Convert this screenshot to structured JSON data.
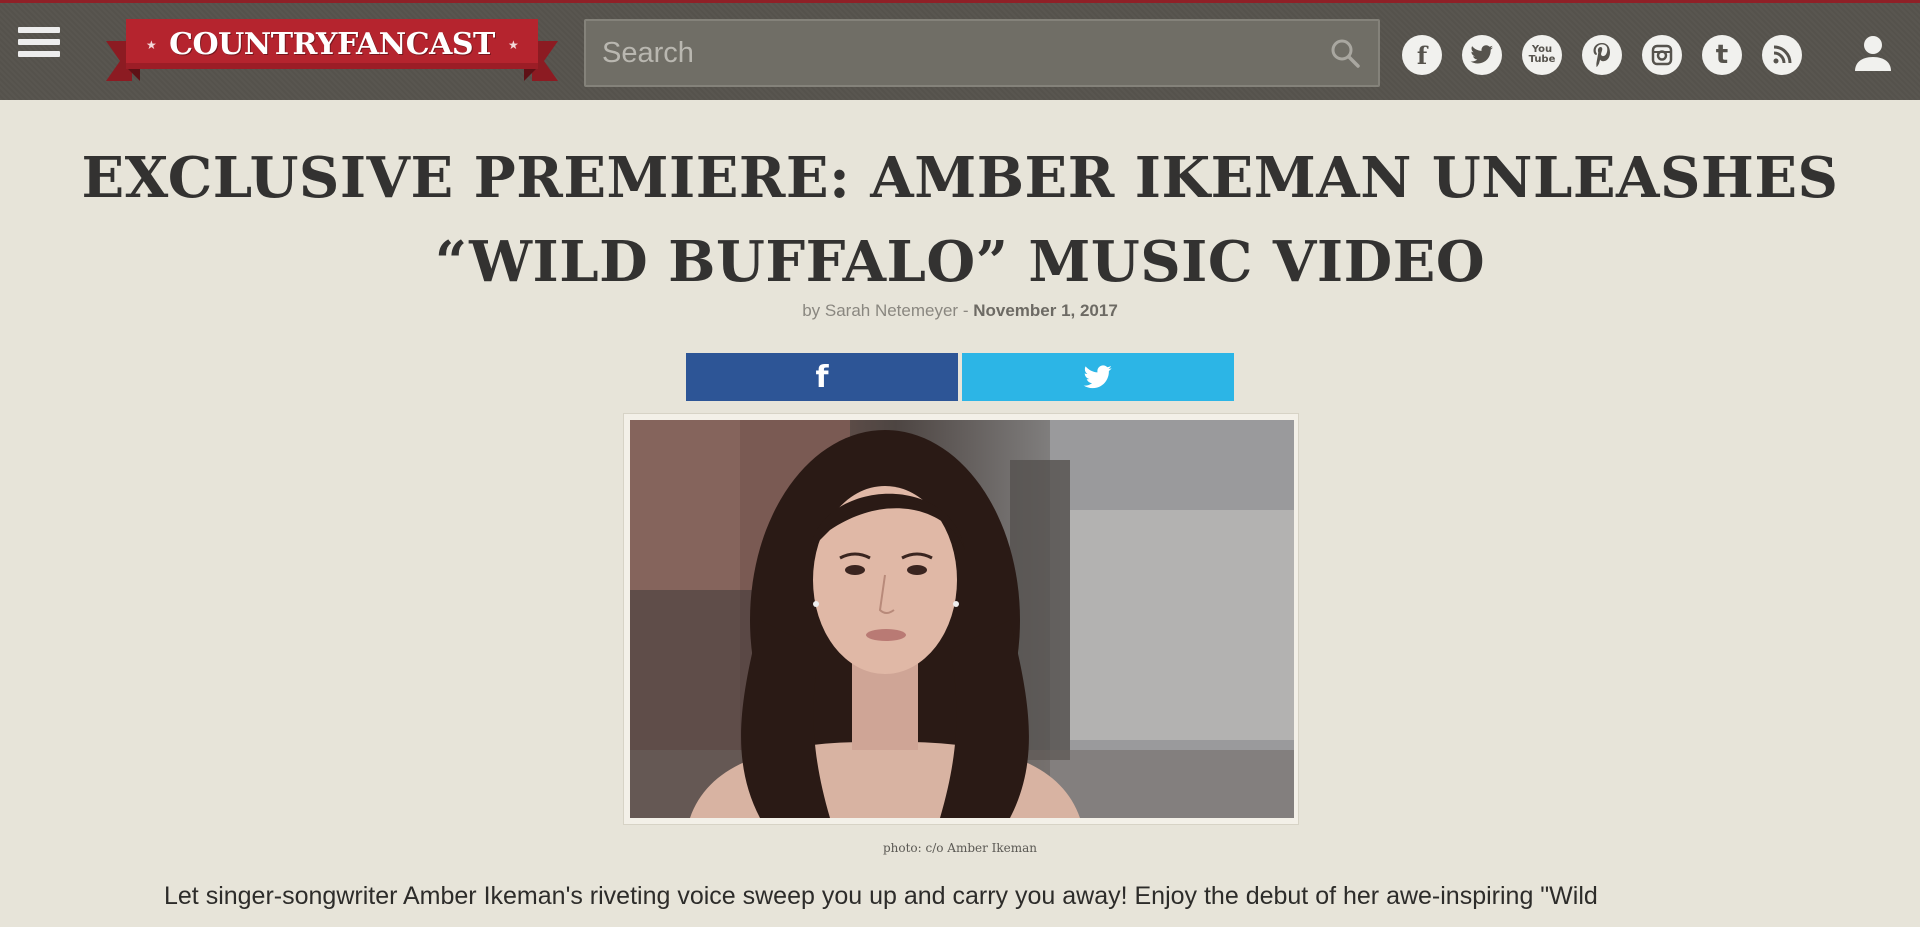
{
  "header": {
    "logo_text": "COUNTRYFANCAST",
    "search_placeholder": "Search",
    "social_icons": [
      "facebook-icon",
      "twitter-icon",
      "youtube-icon",
      "pinterest-icon",
      "instagram-icon",
      "tumblr-icon",
      "rss-icon"
    ],
    "youtube_glyph": "You\nTube",
    "tumblr_glyph": "t"
  },
  "article": {
    "title": "EXCLUSIVE PREMIERE: AMBER IKEMAN UNLEASHES “WILD BUFFALO” MUSIC VIDEO",
    "byline_prefix": "by Sarah Netemeyer - ",
    "date": "November 1, 2017",
    "share_facebook_glyph": "f",
    "photo_caption": "photo: c/o Amber Ikeman",
    "body_text": "Let singer-songwriter Amber Ikeman's riveting voice sweep you up and carry you away! Enjoy the debut of her awe-inspiring \"Wild"
  },
  "colors": {
    "header_bg": "#595650",
    "header_accent": "#8f2027",
    "logo_ribbon": "#b5242e",
    "page_bg": "#e7e4d9",
    "facebook": "#2d5596",
    "twitter": "#2cb5e6"
  }
}
